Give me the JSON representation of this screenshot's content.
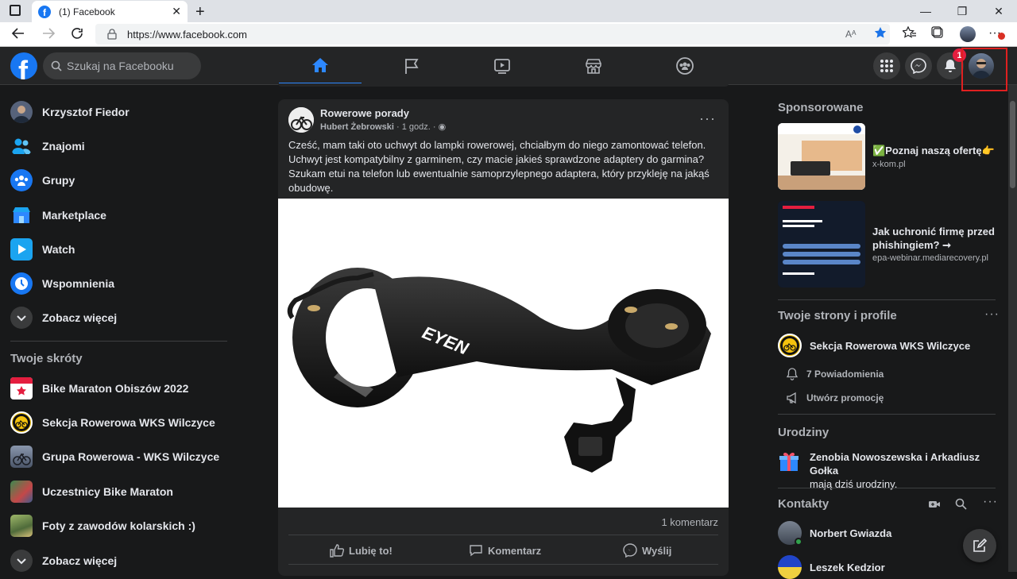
{
  "browser": {
    "tab_title": "(1) Facebook",
    "url": "https://www.facebook.com"
  },
  "header": {
    "search_placeholder": "Szukaj na Facebooku",
    "notification_count": "1"
  },
  "left": {
    "items": [
      {
        "label": "Krzysztof Fiedor",
        "icon": "profile-avatar"
      },
      {
        "label": "Znajomi",
        "icon": "friends-icon"
      },
      {
        "label": "Grupy",
        "icon": "groups-icon"
      },
      {
        "label": "Marketplace",
        "icon": "marketplace-icon"
      },
      {
        "label": "Watch",
        "icon": "watch-icon"
      },
      {
        "label": "Wspomnienia",
        "icon": "memories-icon"
      },
      {
        "label": "Zobacz więcej",
        "icon": "chevron-down-icon"
      }
    ],
    "shortcuts_title": "Twoje skróty",
    "shortcuts": [
      {
        "label": "Bike Maraton Obiszów 2022"
      },
      {
        "label": "Sekcja Rowerowa WKS Wilczyce"
      },
      {
        "label": "Grupa Rowerowa - WKS Wilczyce"
      },
      {
        "label": "Uczestnicy Bike Maraton"
      },
      {
        "label": "Foty z zawodów kolarskich :)"
      },
      {
        "label": "Zobacz więcej"
      }
    ]
  },
  "post": {
    "group": "Rowerowe porady",
    "author": "Hubert Żebrowski",
    "time": "· 1 godz. ·",
    "text": "Cześć, mam taki oto uchwyt do lampki rowerowej, chciałbym do niego zamontować telefon. Uchwyt jest kompatybilny z garminem, czy macie jakieś sprawdzone adaptery do garmina? Szukam etui na telefon lub ewentualnie samoprzylepnego adaptera, który przykleję na jakąś obudowę.",
    "image_logo": "EYEN",
    "comment_count": "1 komentarz",
    "like_label": "Lubię to!",
    "comment_label": "Komentarz",
    "share_label": "Wyślij"
  },
  "right": {
    "sponsored_title": "Sponsorowane",
    "ads": [
      {
        "title": "✅Poznaj naszą ofertę👉",
        "domain": "x-kom.pl"
      },
      {
        "title": "Jak uchronić firmę przed phishingiem? ➞",
        "domain": "epa-webinar.mediarecovery.pl"
      }
    ],
    "pages_title": "Twoje strony i profile",
    "page_name": "Sekcja Rowerowa WKS Wilczyce",
    "page_notifications": "7 Powiadomienia",
    "page_promo": "Utwórz promocję",
    "birthdays_title": "Urodziny",
    "birthdays_names": "Zenobia Nowoszewska i Arkadiusz Gołka",
    "birthdays_suffix": "mają dziś urodziny.",
    "contacts_title": "Kontakty",
    "contacts": [
      {
        "name": "Norbert Gwiazda"
      },
      {
        "name": "Leszek Kedzior"
      }
    ]
  },
  "colors": {
    "bg": "#18191a",
    "surface": "#242526",
    "accent": "#2d88ff",
    "fb_blue": "#1877f2",
    "badge_red": "#e41e3f"
  }
}
